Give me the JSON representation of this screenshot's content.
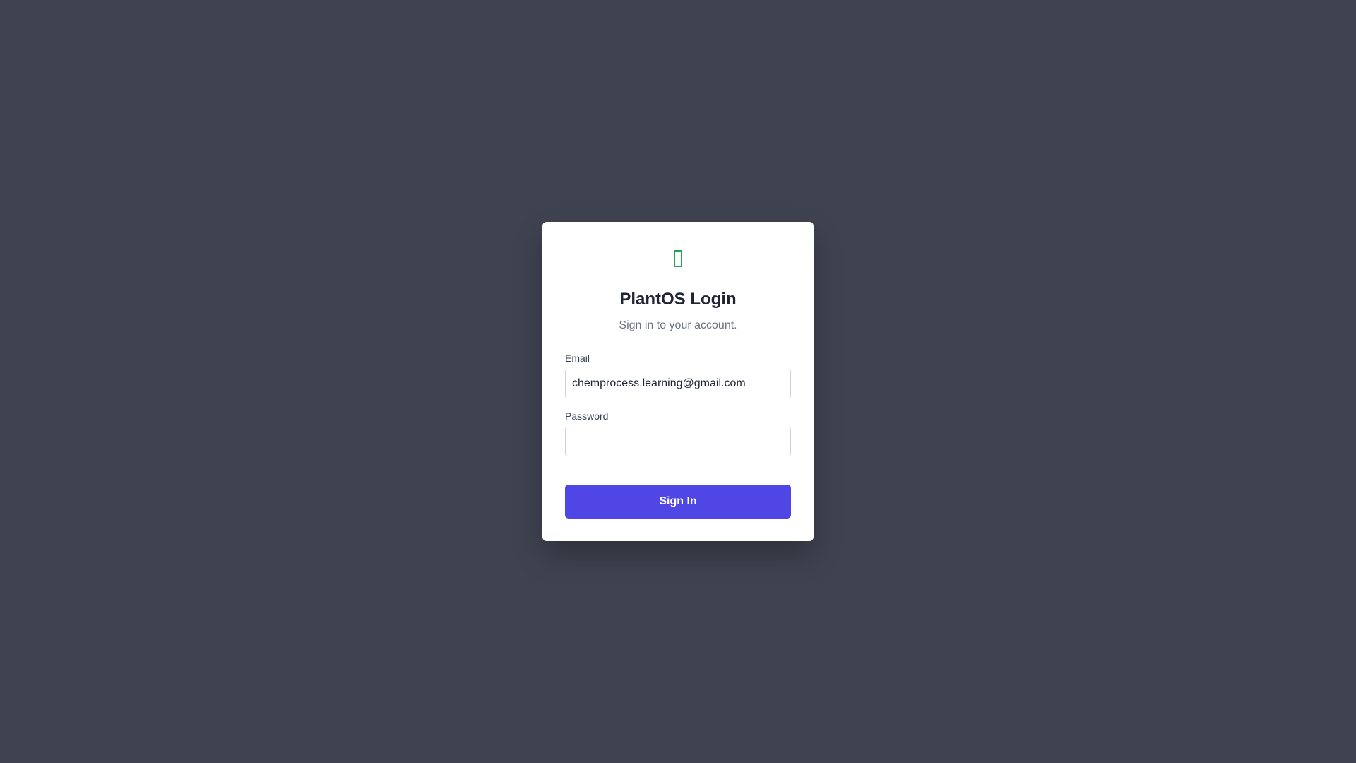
{
  "app": {
    "title": "PlantOS Login",
    "subtitle": "Sign in to your account."
  },
  "logo": {
    "icon": "missing-glyph-icon",
    "color": "#22a55a"
  },
  "form": {
    "email_label": "Email",
    "email_value": "chemprocess.learning@gmail.com",
    "password_label": "Password",
    "password_value": "",
    "submit_label": "Sign In"
  },
  "colors": {
    "background": "#3f4350",
    "card": "#ffffff",
    "accent": "#4f46e5"
  }
}
